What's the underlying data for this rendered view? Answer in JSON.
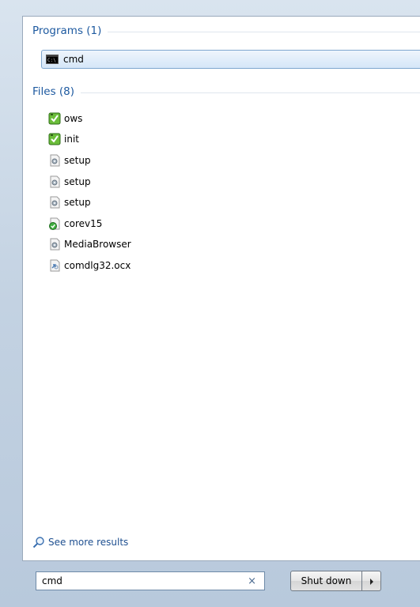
{
  "programs": {
    "header": "Programs (1)",
    "items": [
      {
        "label": "cmd",
        "icon": "cmd-console-icon"
      }
    ]
  },
  "files": {
    "header": "Files (8)",
    "items": [
      {
        "label": "ows",
        "icon": "script-file-icon"
      },
      {
        "label": "init",
        "icon": "script-file-icon"
      },
      {
        "label": "setup",
        "icon": "settings-file-icon"
      },
      {
        "label": "setup",
        "icon": "settings-file-icon"
      },
      {
        "label": "setup",
        "icon": "settings-file-icon"
      },
      {
        "label": "corev15",
        "icon": "checked-file-icon"
      },
      {
        "label": "MediaBrowser",
        "icon": "settings-file-icon"
      },
      {
        "label": "comdlg32.ocx",
        "icon": "activex-file-icon"
      }
    ]
  },
  "see_more": {
    "label": "See more results"
  },
  "search": {
    "value": "cmd",
    "clear": "×"
  },
  "shutdown": {
    "label": "Shut down"
  },
  "colors": {
    "group_title": "#1e5aa0",
    "selection_border": "#7ea6cf",
    "link": "#1e4f90"
  }
}
